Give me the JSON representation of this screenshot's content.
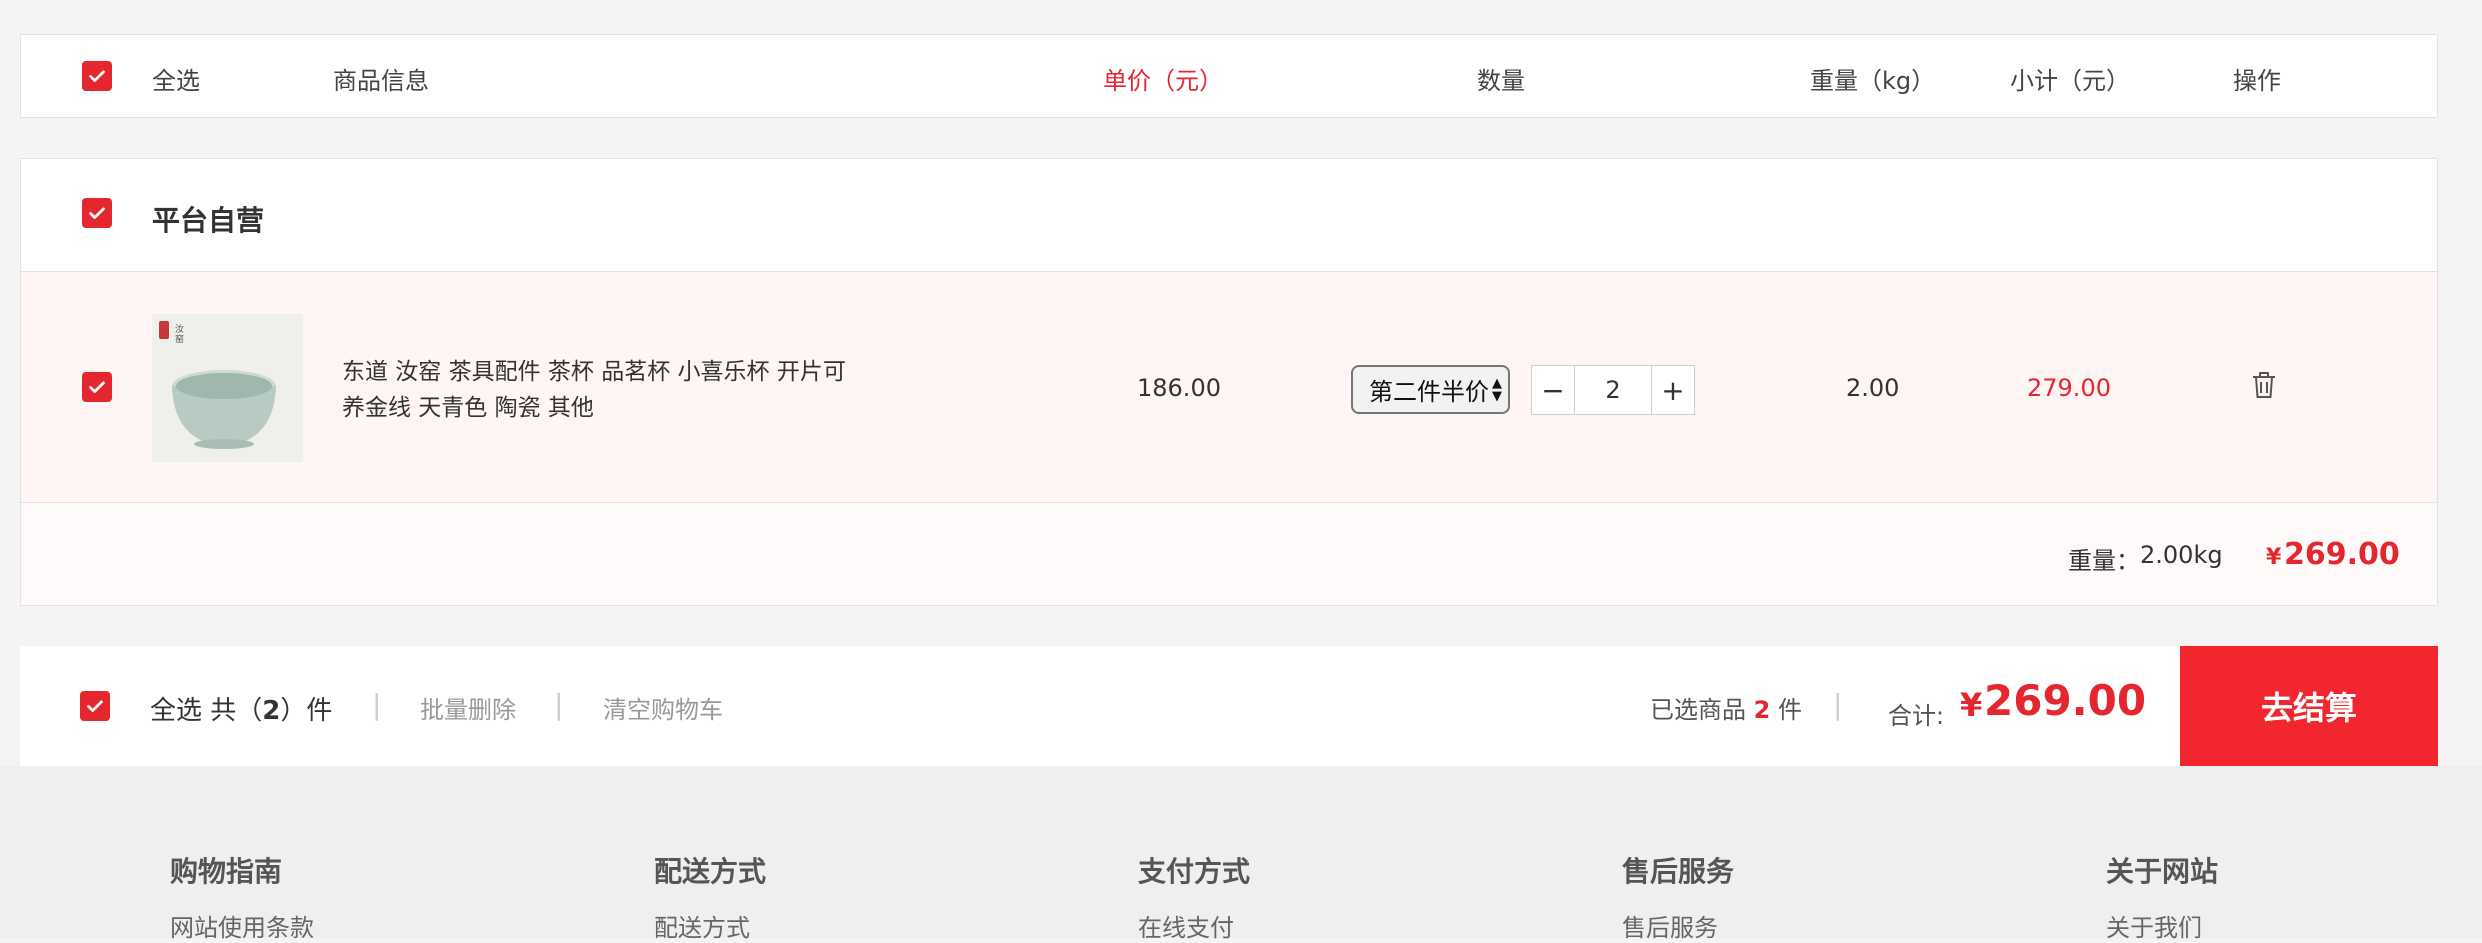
{
  "header": {
    "select_all": "全选",
    "product_info": "商品信息",
    "unit_price": "单价（元）",
    "quantity": "数量",
    "weight": "重量（kg）",
    "subtotal": "小计（元）",
    "actions": "操作"
  },
  "shop": {
    "name": "平台自营",
    "item": {
      "title_line1": "东道 汝窑 茶具配件 茶杯 品茗杯 小喜乐杯 开片可",
      "title_line2": "养金线 天青色 陶瓷 其他",
      "unit_price": "186.00",
      "promo_option": "第二件半价",
      "quantity": "2",
      "weight": "2.00",
      "subtotal": "279.00",
      "image_icon": "teacup-image",
      "delete_icon": "trash-icon"
    },
    "summary": {
      "weight_label": "重量：",
      "weight_value": "2.00kg",
      "currency": "¥",
      "total": "269.00"
    }
  },
  "bottom_bar": {
    "select_all": "全选",
    "count_prefix": "共（",
    "count": "2",
    "count_suffix": "）件",
    "batch_delete": "批量删除",
    "clear_cart": "清空购物车",
    "selected_prefix": "已选商品",
    "selected_count": "2",
    "selected_suffix": "件",
    "total_label": "合计:",
    "currency": "¥",
    "total": "269.00",
    "checkout": "去结算"
  },
  "footer": {
    "columns": [
      {
        "title": "购物指南",
        "link": "网站使用条款"
      },
      {
        "title": "配送方式",
        "link": "配送方式"
      },
      {
        "title": "支付方式",
        "link": "在线支付"
      },
      {
        "title": "售后服务",
        "link": "售后服务"
      },
      {
        "title": "关于网站",
        "link": "关于我们"
      }
    ]
  },
  "colors": {
    "accent": "#e4262e",
    "row_highlight": "#fff5f5",
    "background": "#f4f4f4"
  }
}
